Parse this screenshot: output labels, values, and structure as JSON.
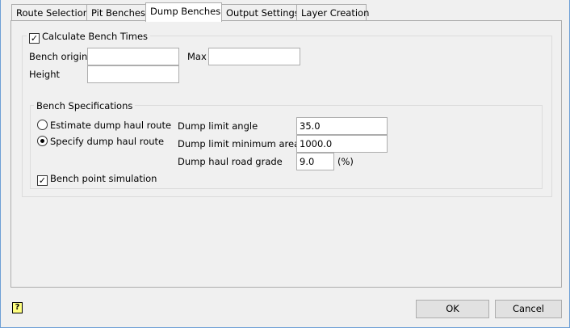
{
  "tabs": [
    {
      "label": "Route Selection"
    },
    {
      "label": "Pit Benches"
    },
    {
      "label": "Dump Benches",
      "selected": true
    },
    {
      "label": "Output Settings"
    },
    {
      "label": "Layer Creation"
    }
  ],
  "calc": {
    "label": "Calculate Bench Times",
    "checked": true,
    "bench_origin_label": "Bench origin",
    "bench_origin": "",
    "max_label": "Max",
    "max": "",
    "height_label": "Height",
    "height": ""
  },
  "specs": {
    "title": "Bench Specifications",
    "estimate_label": "Estimate dump haul route",
    "specify_label": "Specify dump haul route",
    "selected": "specify",
    "angle_label": "Dump limit angle",
    "angle": "35.0",
    "area_label": "Dump limit minimum area",
    "area": "1000.0",
    "grade_label": "Dump haul road grade",
    "grade": "9.0",
    "grade_unit": "(%)",
    "sim_label": "Bench point simulation",
    "sim_checked": true
  },
  "buttons": {
    "ok": "OK",
    "cancel": "Cancel"
  },
  "help_icon": "help-icon"
}
